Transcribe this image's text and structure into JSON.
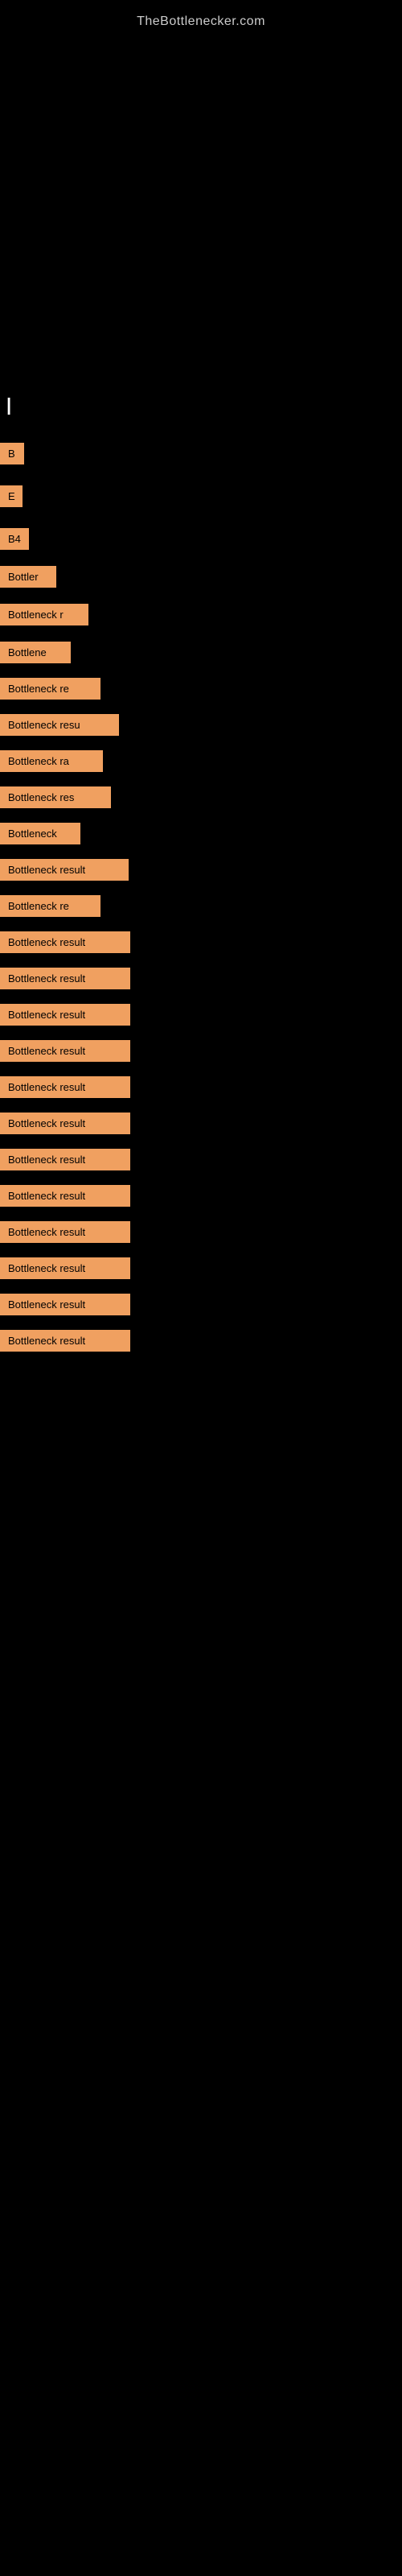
{
  "site": {
    "title": "TheBottlenecker.com"
  },
  "results": [
    {
      "id": 1,
      "label": "B",
      "width": 30,
      "top_gap": 50
    },
    {
      "id": 2,
      "label": "E",
      "width": 28,
      "top_gap": 30
    },
    {
      "id": 3,
      "label": "B4",
      "width": 36,
      "top_gap": 30
    },
    {
      "id": 4,
      "label": "Bottler",
      "width": 70,
      "top_gap": 30
    },
    {
      "id": 5,
      "label": "Bottleneck r",
      "width": 110,
      "top_gap": 28
    },
    {
      "id": 6,
      "label": "Bottlene",
      "width": 88,
      "top_gap": 24
    },
    {
      "id": 7,
      "label": "Bottleneck re",
      "width": 125,
      "top_gap": 24
    },
    {
      "id": 8,
      "label": "Bottleneck resu",
      "width": 148,
      "top_gap": 24
    },
    {
      "id": 9,
      "label": "Bottleneck ra",
      "width": 128,
      "top_gap": 24
    },
    {
      "id": 10,
      "label": "Bottleneck res",
      "width": 138,
      "top_gap": 24
    },
    {
      "id": 11,
      "label": "Bottleneck",
      "width": 100,
      "top_gap": 24
    },
    {
      "id": 12,
      "label": "Bottleneck result",
      "width": 160,
      "top_gap": 24
    },
    {
      "id": 13,
      "label": "Bottleneck re",
      "width": 125,
      "top_gap": 24
    },
    {
      "id": 14,
      "label": "Bottleneck result",
      "width": 162,
      "top_gap": 24
    },
    {
      "id": 15,
      "label": "Bottleneck result",
      "width": 162,
      "top_gap": 24
    },
    {
      "id": 16,
      "label": "Bottleneck result",
      "width": 162,
      "top_gap": 24
    },
    {
      "id": 17,
      "label": "Bottleneck result",
      "width": 162,
      "top_gap": 24
    },
    {
      "id": 18,
      "label": "Bottleneck result",
      "width": 162,
      "top_gap": 24
    },
    {
      "id": 19,
      "label": "Bottleneck result",
      "width": 162,
      "top_gap": 24
    },
    {
      "id": 20,
      "label": "Bottleneck result",
      "width": 162,
      "top_gap": 24
    },
    {
      "id": 21,
      "label": "Bottleneck result",
      "width": 162,
      "top_gap": 24
    },
    {
      "id": 22,
      "label": "Bottleneck result",
      "width": 162,
      "top_gap": 24
    },
    {
      "id": 23,
      "label": "Bottleneck result",
      "width": 162,
      "top_gap": 24
    },
    {
      "id": 24,
      "label": "Bottleneck result",
      "width": 162,
      "top_gap": 24
    },
    {
      "id": 25,
      "label": "Bottleneck result",
      "width": 162,
      "top_gap": 24
    }
  ],
  "colors": {
    "background": "#000000",
    "bar_fill": "#f0a060",
    "text": "#ffffff",
    "site_title": "#cccccc"
  }
}
